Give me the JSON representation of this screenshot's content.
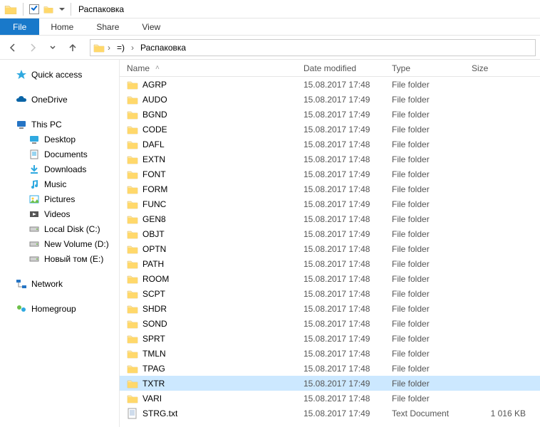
{
  "window": {
    "title": "Распаковка"
  },
  "ribbon": {
    "file": "File",
    "tabs": [
      "Home",
      "Share",
      "View"
    ]
  },
  "breadcrumb": {
    "items": [
      "=)",
      "Распаковка"
    ]
  },
  "nav": {
    "quick_access": "Quick access",
    "onedrive": "OneDrive",
    "this_pc": "This PC",
    "this_pc_children": [
      {
        "icon": "desktop",
        "label": "Desktop"
      },
      {
        "icon": "documents",
        "label": "Documents"
      },
      {
        "icon": "downloads",
        "label": "Downloads"
      },
      {
        "icon": "music",
        "label": "Music"
      },
      {
        "icon": "pictures",
        "label": "Pictures"
      },
      {
        "icon": "videos",
        "label": "Videos"
      },
      {
        "icon": "drive",
        "label": "Local Disk (C:)"
      },
      {
        "icon": "drive",
        "label": "New Volume (D:)"
      },
      {
        "icon": "drive",
        "label": "Новый том (E:)"
      }
    ],
    "network": "Network",
    "homegroup": "Homegroup"
  },
  "columns": {
    "name": "Name",
    "date": "Date modified",
    "type": "Type",
    "size": "Size"
  },
  "type_labels": {
    "folder": "File folder",
    "text": "Text Document"
  },
  "files": [
    {
      "name": "AGRP",
      "date": "15.08.2017 17:48",
      "kind": "folder",
      "size": ""
    },
    {
      "name": "AUDO",
      "date": "15.08.2017 17:49",
      "kind": "folder",
      "size": ""
    },
    {
      "name": "BGND",
      "date": "15.08.2017 17:49",
      "kind": "folder",
      "size": ""
    },
    {
      "name": "CODE",
      "date": "15.08.2017 17:49",
      "kind": "folder",
      "size": ""
    },
    {
      "name": "DAFL",
      "date": "15.08.2017 17:48",
      "kind": "folder",
      "size": ""
    },
    {
      "name": "EXTN",
      "date": "15.08.2017 17:48",
      "kind": "folder",
      "size": ""
    },
    {
      "name": "FONT",
      "date": "15.08.2017 17:49",
      "kind": "folder",
      "size": ""
    },
    {
      "name": "FORM",
      "date": "15.08.2017 17:48",
      "kind": "folder",
      "size": ""
    },
    {
      "name": "FUNC",
      "date": "15.08.2017 17:49",
      "kind": "folder",
      "size": ""
    },
    {
      "name": "GEN8",
      "date": "15.08.2017 17:48",
      "kind": "folder",
      "size": ""
    },
    {
      "name": "OBJT",
      "date": "15.08.2017 17:49",
      "kind": "folder",
      "size": ""
    },
    {
      "name": "OPTN",
      "date": "15.08.2017 17:48",
      "kind": "folder",
      "size": ""
    },
    {
      "name": "PATH",
      "date": "15.08.2017 17:48",
      "kind": "folder",
      "size": ""
    },
    {
      "name": "ROOM",
      "date": "15.08.2017 17:48",
      "kind": "folder",
      "size": ""
    },
    {
      "name": "SCPT",
      "date": "15.08.2017 17:48",
      "kind": "folder",
      "size": ""
    },
    {
      "name": "SHDR",
      "date": "15.08.2017 17:48",
      "kind": "folder",
      "size": ""
    },
    {
      "name": "SOND",
      "date": "15.08.2017 17:48",
      "kind": "folder",
      "size": ""
    },
    {
      "name": "SPRT",
      "date": "15.08.2017 17:49",
      "kind": "folder",
      "size": ""
    },
    {
      "name": "TMLN",
      "date": "15.08.2017 17:48",
      "kind": "folder",
      "size": ""
    },
    {
      "name": "TPAG",
      "date": "15.08.2017 17:48",
      "kind": "folder",
      "size": ""
    },
    {
      "name": "TXTR",
      "date": "15.08.2017 17:49",
      "kind": "folder",
      "size": "",
      "selected": true
    },
    {
      "name": "VARI",
      "date": "15.08.2017 17:48",
      "kind": "folder",
      "size": ""
    },
    {
      "name": "STRG.txt",
      "date": "15.08.2017 17:49",
      "kind": "text",
      "size": "1 016 KB"
    }
  ]
}
